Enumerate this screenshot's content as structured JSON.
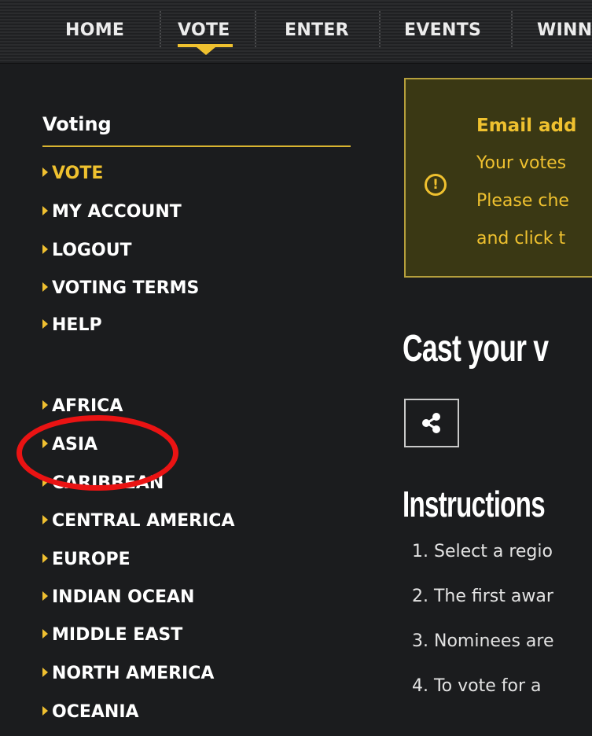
{
  "nav": {
    "items": [
      {
        "label": "HOME"
      },
      {
        "label": "VOTE"
      },
      {
        "label": "ENTER"
      },
      {
        "label": "EVENTS"
      },
      {
        "label": "WINN"
      }
    ],
    "active": "VOTE"
  },
  "sidebar": {
    "title": "Voting",
    "account_links": [
      {
        "label": "VOTE"
      },
      {
        "label": "MY ACCOUNT"
      },
      {
        "label": "LOGOUT"
      },
      {
        "label": "VOTING TERMS"
      },
      {
        "label": "HELP"
      }
    ],
    "regions": [
      {
        "label": "AFRICA"
      },
      {
        "label": "ASIA"
      },
      {
        "label": "CARIBBEAN"
      },
      {
        "label": "CENTRAL AMERICA"
      },
      {
        "label": "EUROPE"
      },
      {
        "label": "INDIAN OCEAN"
      },
      {
        "label": "MIDDLE EAST"
      },
      {
        "label": "NORTH AMERICA"
      },
      {
        "label": "OCEANIA"
      }
    ]
  },
  "notice": {
    "icon": "exclamation-circle-icon",
    "icon_glyph": "!",
    "title": "Email add",
    "lines": [
      "Your votes",
      "Please che",
      "and click t"
    ]
  },
  "main": {
    "title": "Cast your v",
    "share_icon": "share-icon",
    "instructions_title": "Instructions",
    "instructions": [
      "1. Select a regio",
      "2. The first awar",
      "3. Nominees are",
      "4. To vote for a"
    ]
  },
  "colors": {
    "accent": "#efc12f",
    "background": "#1b1c1e",
    "notice_bg": "#3a3814",
    "highlight_circle": "#ea1313"
  }
}
